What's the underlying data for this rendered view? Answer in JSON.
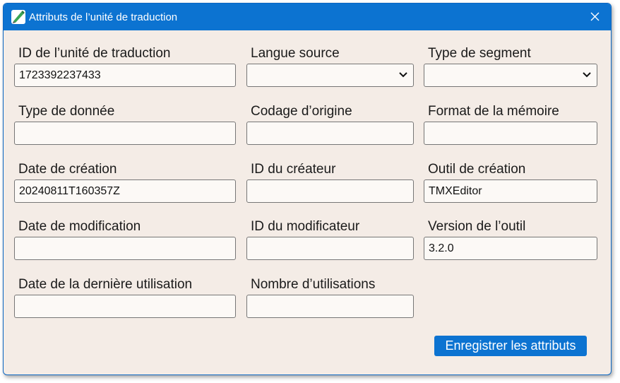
{
  "window": {
    "title": "Attributs de l’unité de traduction",
    "close_icon": "close-icon",
    "app_icon": "tmxeditor-app-icon"
  },
  "fields": {
    "tuid": {
      "label": "ID de l’unité de traduction",
      "value": "1723392237433"
    },
    "srclang": {
      "label": "Langue source",
      "value": ""
    },
    "segtype": {
      "label": "Type de segment",
      "value": ""
    },
    "datatype": {
      "label": "Type de donnée",
      "value": ""
    },
    "o_encoding": {
      "label": "Codage d’origine",
      "value": ""
    },
    "o_tmf": {
      "label": "Format de la mémoire",
      "value": ""
    },
    "creationdate": {
      "label": "Date de création",
      "value": "20240811T160357Z"
    },
    "creationid": {
      "label": "ID du créateur",
      "value": ""
    },
    "creationtool": {
      "label": "Outil de création",
      "value": "TMXEditor"
    },
    "changedate": {
      "label": "Date de modification",
      "value": ""
    },
    "changeid": {
      "label": "ID du modificateur",
      "value": ""
    },
    "creationtoolversion": {
      "label": "Version de l’outil",
      "value": "3.2.0"
    },
    "lastusagedate": {
      "label": "Date de la dernière utilisation",
      "value": ""
    },
    "usagecount": {
      "label": "Nombre d’utilisations",
      "value": ""
    }
  },
  "actions": {
    "save_label": "Enregistrer les attributs"
  },
  "colors": {
    "accent": "#0c73d1",
    "background": "#f4ece6",
    "input_background": "#fcf9f6"
  }
}
